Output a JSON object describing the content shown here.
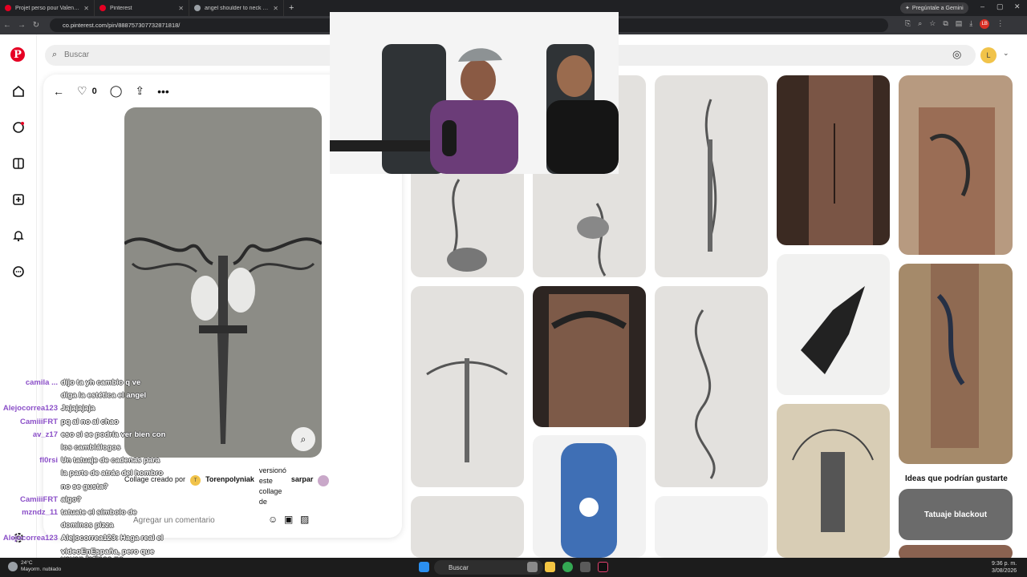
{
  "browser": {
    "tabs": [
      {
        "title": "Projet perso pour Valentin✨ Mes",
        "active": false
      },
      {
        "title": "Pinterest",
        "active": true
      },
      {
        "title": "angel shoulder to neck tattoo - B",
        "active": false
      }
    ],
    "gemini_label": "Pregúntale a Gemini",
    "url": "co.pinterest.com/pin/888757307732871818/"
  },
  "header": {
    "search_placeholder": "Buscar",
    "user_initial": "L"
  },
  "pin": {
    "likes": "0",
    "collage_prefix": "Collage creado por",
    "creator_initial": "T",
    "creator": "Torenpolyniak",
    "verb_text": "versionó este collage de",
    "source_user": "sarpar",
    "comment_placeholder": "Agregar un comentario"
  },
  "sidebar_ideas": {
    "title": "Ideas que podrían gustarte",
    "blackout": "Tatuaje blackout"
  },
  "chat": [
    {
      "user": "camila ...",
      "msg": "dijo ta yh cambio q ve"
    },
    {
      "user": "",
      "msg": "diga la estética el angel"
    },
    {
      "user": "Alejocorrea123",
      "msg": "Jajajajaja"
    },
    {
      "user": "CamiiiFRT",
      "msg": "pq al no al chao"
    },
    {
      "user": "av_z17",
      "msg": "eso si se podría ver bien con"
    },
    {
      "user": "",
      "msg": "los cambiálogos"
    },
    {
      "user": "fl0rsi",
      "msg": "Un tatuaje de cadenas para"
    },
    {
      "user": "",
      "msg": "la parte de atrás del hombro"
    },
    {
      "user": "",
      "msg": "no se gusta?"
    },
    {
      "user": "CamiiiFRT",
      "msg": "algo?"
    },
    {
      "user": "mzndz_11",
      "msg": "tatuate el símbolo de"
    },
    {
      "user": "",
      "msg": "dominos pizza"
    },
    {
      "user": "Alejocorrea123",
      "msg": "Alejocorrea123: Haga real el"
    },
    {
      "user": "",
      "msg": "videoEnEspaña, pero que"
    }
  ],
  "chat_last": "vayan latinos ps",
  "taskbar": {
    "temp": "24°C",
    "weather": "Mayorm. nublado",
    "search": "Buscar",
    "time": "9:36 p. m.",
    "date": "3/08/2026"
  }
}
